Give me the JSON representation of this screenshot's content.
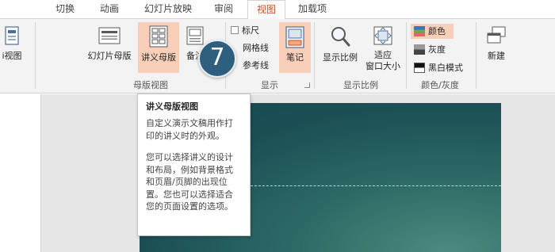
{
  "tabs": [
    {
      "label": "切换",
      "active": false
    },
    {
      "label": "动画",
      "active": false
    },
    {
      "label": "幻灯片放映",
      "active": false
    },
    {
      "label": "审阅",
      "active": false
    },
    {
      "label": "视图",
      "active": true
    },
    {
      "label": "加载项",
      "active": false
    }
  ],
  "ribbon": {
    "partial_view_label": "i视图",
    "master_views": {
      "slide_master": "幻灯片母版",
      "handout_master": "讲义母版",
      "notes_master_partial": "备注",
      "group_label": "母版视图"
    },
    "show": {
      "ruler": "标尺",
      "gridlines_partial": "网格线",
      "guides_partial": "参考线",
      "group_label": "显示"
    },
    "notes": "笔记",
    "zoom": {
      "zoom_label": "显示比例",
      "fit_line1": "适应",
      "fit_line2": "窗口大小",
      "group_label": "显示比例"
    },
    "color": {
      "color": "颜色",
      "grayscale": "灰度",
      "bw": "黑白模式",
      "group_label": "颜色/灰度"
    },
    "new_window_partial": "新建"
  },
  "badge": {
    "number": "7"
  },
  "tooltip": {
    "title": "讲义母版视图",
    "p1_l1": "自定义演示文稿用作打",
    "p1_l2": "印的讲义时的外观。",
    "p2_l1": "您可以选择讲义的设计",
    "p2_l2": "和布局，例如背景格式",
    "p2_l3": "和页眉/页脚的出现位",
    "p2_l4": "置。您也可以选择适合",
    "p2_l5": "您的页面设置的选项。"
  },
  "colors": {
    "active_tab_text": "#c2502a",
    "highlight": "#f9cfb9",
    "badge": "#2e5f7f",
    "slide_dark": "#174450",
    "slide_light": "#4c8b7e"
  }
}
